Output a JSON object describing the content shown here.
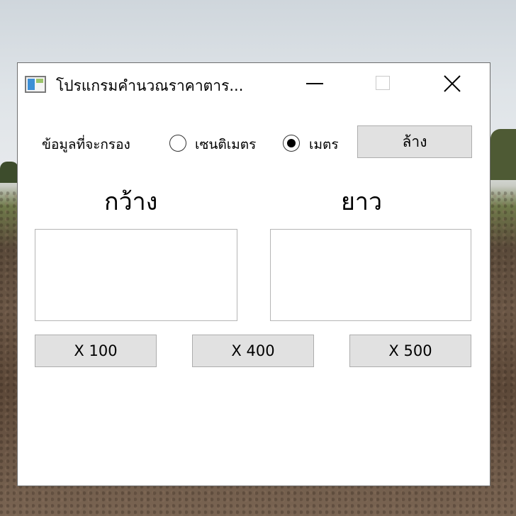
{
  "window": {
    "title": "โปรแกรมคำนวณราคาตาร...",
    "minimize_icon": "minimize-icon",
    "maximize_icon": "maximize-icon",
    "close_icon": "close-icon"
  },
  "filter": {
    "label": "ข้อมูลที่จะกรอง",
    "options": [
      {
        "label": "เซนติเมตร",
        "checked": false
      },
      {
        "label": "เมตร",
        "checked": true
      }
    ],
    "clear_label": "ล้าง"
  },
  "fields": {
    "width_label": "กว้าง",
    "length_label": "ยาว",
    "width_value": "",
    "length_value": ""
  },
  "multipliers": [
    "X 100",
    "X 400",
    "X 500"
  ],
  "colors": {
    "button_bg": "#e1e1e1",
    "window_bg": "#ffffff"
  }
}
